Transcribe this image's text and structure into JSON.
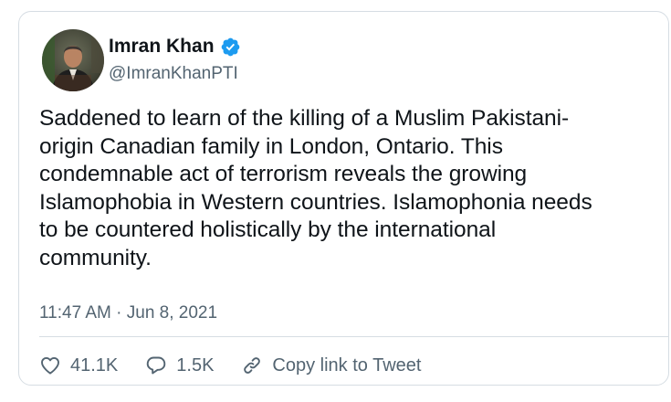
{
  "user": {
    "display_name": "Imran Khan",
    "handle": "@ImranKhanPTI",
    "verified": true,
    "avatar_icon": "profile-photo"
  },
  "tweet": {
    "text": "Saddened to learn of the killing of a Muslim Pakistani-\norigin Canadian family in London, Ontario. This\ncondemnable act of terrorism reveals the growing\nIslamophobia in Western countries. Islamophonia needs\nto be countered holistically by the international\ncommunity.",
    "timestamp": "11:47 AM · Jun 8, 2021"
  },
  "actions": {
    "like_count": "41.1K",
    "reply_count": "1.5K",
    "copy_link_label": "Copy link to Tweet"
  },
  "colors": {
    "verified_blue": "#1d9bf0",
    "secondary_text": "#536471",
    "primary_text": "#0f1419",
    "border": "#d6dde3"
  }
}
